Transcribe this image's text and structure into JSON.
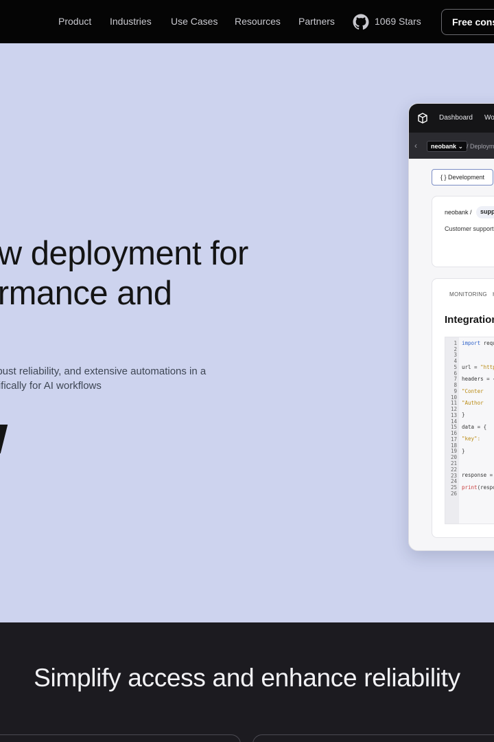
{
  "nav": {
    "items": [
      "Product",
      "Industries",
      "Use Cases",
      "Resources",
      "Partners"
    ],
    "github_icon": "github-icon",
    "stars": "1069 Stars",
    "cta_label": "Free cons"
  },
  "hero": {
    "title_line1": "ow deployment for",
    "title_line2": "ormance and",
    "subtitle_line1": " robust reliability, and extensive automations in a",
    "subtitle_line2": "ecifically for AI workflows"
  },
  "mockup": {
    "nav": [
      "Dashboard",
      "Wo"
    ],
    "project_select": "neobank",
    "breadcrumb": "/ Deploym",
    "env_button": "{ } Development",
    "card": {
      "path": "neobank /",
      "pill": "supp",
      "description": "Customer support neobank"
    },
    "tabs": [
      "MONITORING",
      "H"
    ],
    "integration_heading": "Integration",
    "code_lines": [
      {
        "n": "1",
        "text": "import requ"
      },
      {
        "n": "2",
        "text": ""
      },
      {
        "n": "3",
        "text": ""
      },
      {
        "n": "4",
        "text": ""
      },
      {
        "n": "5",
        "text": "url = \"http"
      },
      {
        "n": "6",
        "text": "headers = {"
      },
      {
        "n": "7",
        "text": ""
      },
      {
        "n": "8",
        "text": "    \"Conter"
      },
      {
        "n": "9",
        "text": ""
      },
      {
        "n": "10",
        "text": "    \"Author"
      },
      {
        "n": "11",
        "text": ""
      },
      {
        "n": "12",
        "text": "}"
      },
      {
        "n": "13",
        "text": ""
      },
      {
        "n": "14",
        "text": "data = {"
      },
      {
        "n": "15",
        "text": ""
      },
      {
        "n": "16",
        "text": "    \"key\":"
      },
      {
        "n": "17",
        "text": ""
      },
      {
        "n": "18",
        "text": "}"
      },
      {
        "n": "19",
        "text": ""
      },
      {
        "n": "20",
        "text": ""
      },
      {
        "n": "21",
        "text": "response ="
      },
      {
        "n": "22",
        "text": ""
      },
      {
        "n": "23",
        "text": "print(respo"
      },
      {
        "n": "24",
        "text": ""
      },
      {
        "n": "25",
        "text": ""
      },
      {
        "n": "26",
        "text": ""
      }
    ]
  },
  "section2": {
    "title": "Simplify access and enhance reliability"
  }
}
